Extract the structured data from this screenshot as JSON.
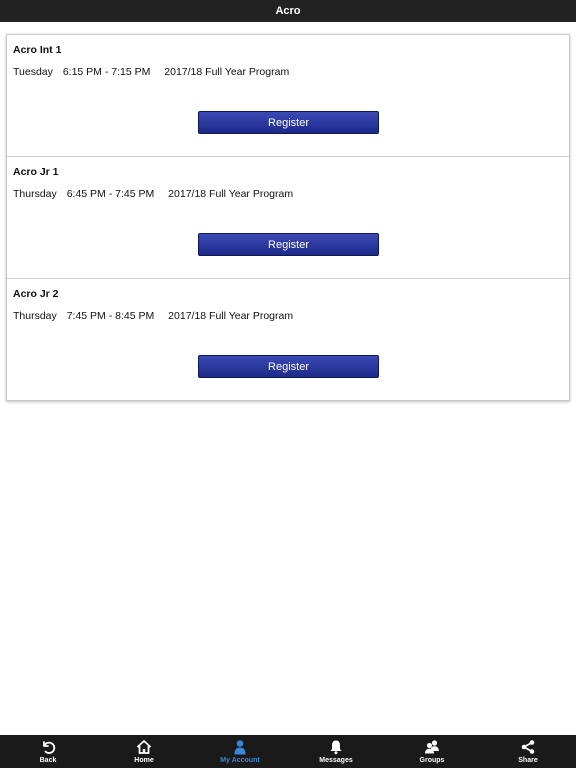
{
  "header": {
    "title": "Acro"
  },
  "classes": [
    {
      "name": "Acro Int 1",
      "day": "Tuesday",
      "time": "6:15 PM - 7:15 PM",
      "program": "2017/18 Full Year Program",
      "button": "Register"
    },
    {
      "name": "Acro Jr 1",
      "day": "Thursday",
      "time": "6:45 PM - 7:45 PM",
      "program": "2017/18 Full Year Program",
      "button": "Register"
    },
    {
      "name": "Acro Jr 2",
      "day": "Thursday",
      "time": "7:45 PM - 8:45 PM",
      "program": "2017/18 Full Year Program",
      "button": "Register"
    }
  ],
  "tabs": [
    {
      "label": "Back",
      "icon": "back-icon"
    },
    {
      "label": "Home",
      "icon": "home-icon"
    },
    {
      "label": "My Account",
      "icon": "user-icon",
      "active": true
    },
    {
      "label": "Messages",
      "icon": "bell-icon"
    },
    {
      "label": "Groups",
      "icon": "groups-icon"
    },
    {
      "label": "Share",
      "icon": "share-icon"
    }
  ],
  "colors": {
    "topbar": "#222222",
    "tabbar": "#1a1a1a",
    "button": "#2a3a9e",
    "active_tab": "#3a86d8"
  }
}
